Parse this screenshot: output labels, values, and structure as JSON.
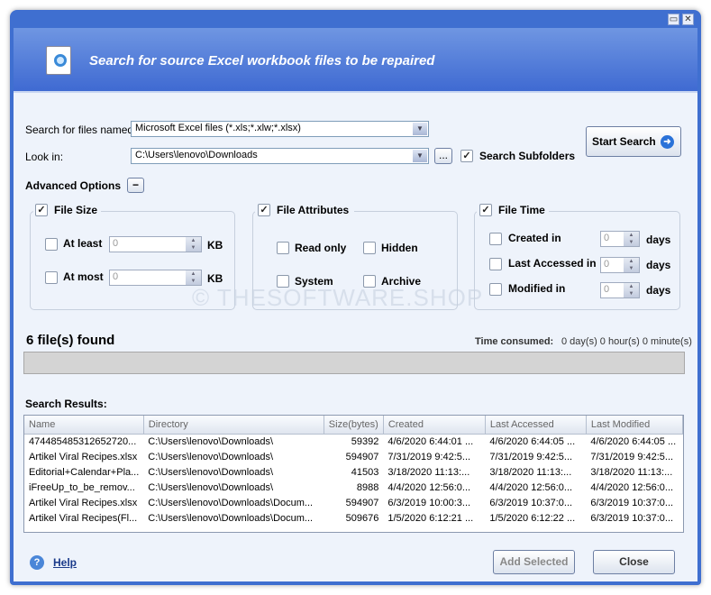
{
  "header": {
    "title": "Search for source Excel workbook files to be repaired"
  },
  "form": {
    "search_label": "Search for files named:",
    "search_value": "Microsoft Excel files (*.xls;*.xlw;*.xlsx)",
    "lookin_label": "Look in:",
    "lookin_value": "C:\\Users\\lenovo\\Downloads",
    "browse": "...",
    "subfolders": "Search Subfolders",
    "start_search": "Start Search"
  },
  "advanced": {
    "label": "Advanced Options",
    "toggle": "−",
    "file_size": {
      "title": "File Size",
      "at_least": "At least",
      "at_most": "At most",
      "value": "0",
      "unit": "KB"
    },
    "file_attr": {
      "title": "File Attributes",
      "read_only": "Read only",
      "hidden": "Hidden",
      "system": "System",
      "archive": "Archive"
    },
    "file_time": {
      "title": "File Time",
      "created": "Created in",
      "accessed": "Last Accessed in",
      "modified": "Modified in",
      "value": "0",
      "unit": "days"
    }
  },
  "watermark": "© THESOFTWARE.SHOP",
  "status": {
    "found": "6 file(s) found",
    "time_label": "Time consumed:",
    "time_value": "0 day(s) 0 hour(s) 0 minute(s)",
    "progress": 0
  },
  "results": {
    "label": "Search Results:",
    "columns": [
      "Name",
      "Directory",
      "Size(bytes)",
      "Created",
      "Last Accessed",
      "Last Modified"
    ],
    "rows": [
      [
        "474485485312652720...",
        "C:\\Users\\lenovo\\Downloads\\",
        "59392",
        "4/6/2020 6:44:01 ...",
        "4/6/2020 6:44:05 ...",
        "4/6/2020 6:44:05 ..."
      ],
      [
        "Artikel Viral Recipes.xlsx",
        "C:\\Users\\lenovo\\Downloads\\",
        "594907",
        "7/31/2019 9:42:5...",
        "7/31/2019 9:42:5...",
        "7/31/2019 9:42:5..."
      ],
      [
        "Editorial+Calendar+Pla...",
        "C:\\Users\\lenovo\\Downloads\\",
        "41503",
        "3/18/2020 11:13:...",
        "3/18/2020 11:13:...",
        "3/18/2020 11:13:..."
      ],
      [
        "iFreeUp_to_be_remov...",
        "C:\\Users\\lenovo\\Downloads\\",
        "8988",
        "4/4/2020 12:56:0...",
        "4/4/2020 12:56:0...",
        "4/4/2020 12:56:0..."
      ],
      [
        "Artikel Viral Recipes.xlsx",
        "C:\\Users\\lenovo\\Downloads\\Docum...",
        "594907",
        "6/3/2019 10:00:3...",
        "6/3/2019 10:37:0...",
        "6/3/2019 10:37:0..."
      ],
      [
        "Artikel Viral Recipes(Fl...",
        "C:\\Users\\lenovo\\Downloads\\Docum...",
        "509676",
        "1/5/2020 6:12:21 ...",
        "1/5/2020 6:12:22 ...",
        "6/3/2019 10:37:0..."
      ]
    ]
  },
  "footer": {
    "help": "Help",
    "add_selected": "Add Selected",
    "close": "Close"
  }
}
